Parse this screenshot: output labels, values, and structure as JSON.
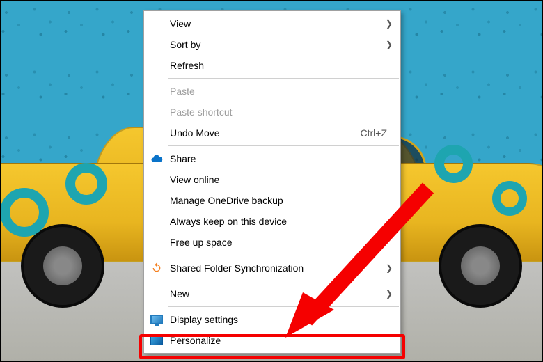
{
  "menu": {
    "view": "View",
    "sort_by": "Sort by",
    "refresh": "Refresh",
    "paste": "Paste",
    "paste_shortcut": "Paste shortcut",
    "undo_move": "Undo Move",
    "undo_shortcut": "Ctrl+Z",
    "share": "Share",
    "view_online": "View online",
    "manage_onedrive": "Manage OneDrive backup",
    "always_keep": "Always keep on this device",
    "free_up": "Free up space",
    "shared_folder_sync": "Shared Folder Synchronization",
    "new": "New",
    "display_settings": "Display settings",
    "personalize": "Personalize"
  }
}
